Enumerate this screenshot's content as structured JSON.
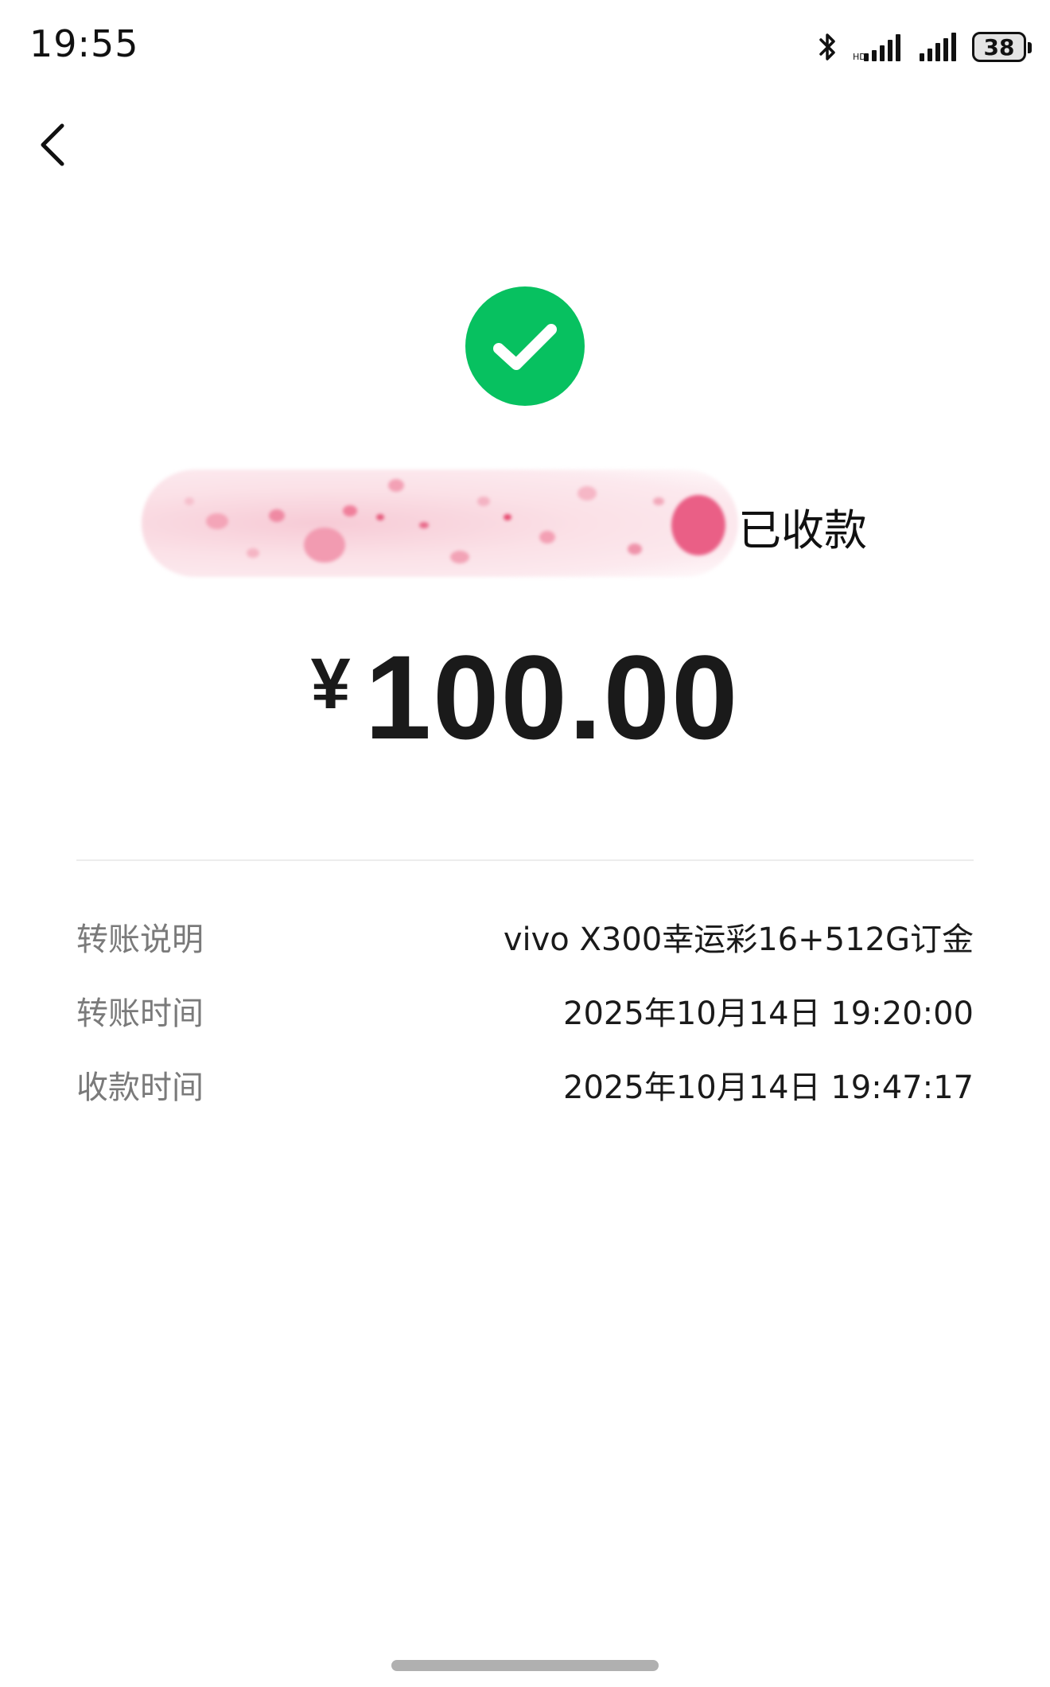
{
  "status_bar": {
    "time": "19:55",
    "battery": "38",
    "icons": [
      "bluetooth-icon",
      "signal-icon",
      "signal-icon",
      "battery-icon"
    ]
  },
  "nav": {
    "back_icon": "chevron-left-icon"
  },
  "result": {
    "icon": "check-circle-icon",
    "accent_color": "#07c160",
    "status_text": "已收款"
  },
  "amount": {
    "currency": "¥",
    "value": "100.00"
  },
  "details": [
    {
      "label": "转账说明",
      "value": "vivo X300幸运彩16+512G订金"
    },
    {
      "label": "转账时间",
      "value": "2025年10月14日 19:20:00"
    },
    {
      "label": "收款时间",
      "value": "2025年10月14日 19:47:17"
    }
  ]
}
